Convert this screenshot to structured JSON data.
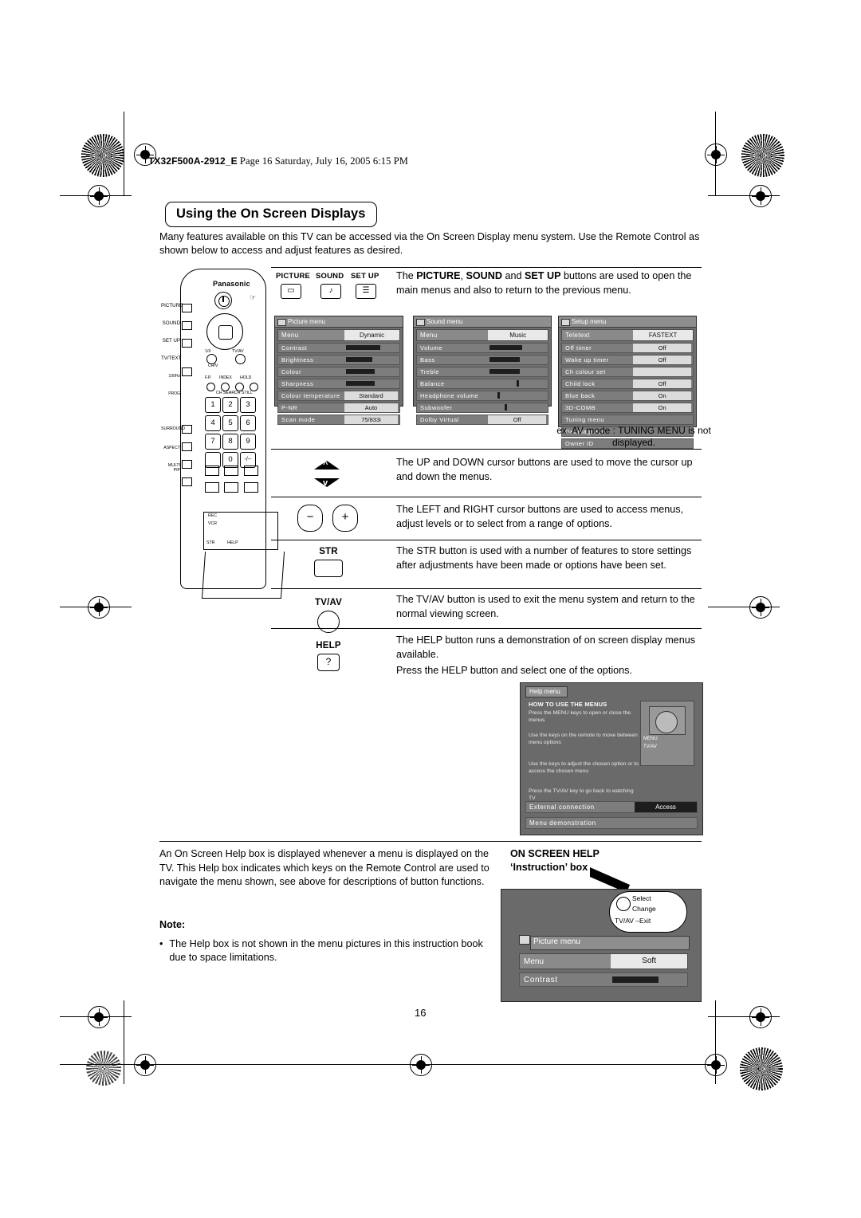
{
  "header": {
    "filename": "TX32F500A-2912_E",
    "pageinfo": "Page 16  Saturday, July 16, 2005  6:15 PM"
  },
  "title": "Using the On Screen Displays",
  "intro": "Many features available on this TV can be accessed via the On Screen Display menu system. Use the Remote Control as shown below to access and adjust features as desired.",
  "remote": {
    "brand": "Panasonic",
    "side_labels": [
      "PICTURE",
      "SOUND",
      "SET UP",
      "TV/TEXT",
      "100Hz PROG"
    ],
    "mid_labels": [
      "F.P.",
      "INDEX",
      "HOLD",
      "CH SEARCH",
      "STILL"
    ],
    "left_labels": [
      "SURROUND",
      "ASPECT",
      "MULTI PIP"
    ],
    "vol_label": "TV/AV",
    "ch_label": "CH/V",
    "prog_label": "1/II",
    "numbers": [
      "1",
      "2",
      "3",
      "4",
      "5",
      "6",
      "7",
      "8",
      "9",
      "0"
    ],
    "dash_key": "-/--",
    "flap_labels": [
      "REC",
      "VCR",
      "STR",
      "HELP"
    ]
  },
  "topbuttons": [
    {
      "label": "PICTURE",
      "glyph": "▭"
    },
    {
      "label": "SOUND",
      "glyph": "♪"
    },
    {
      "label": "SET UP",
      "glyph": "☰"
    }
  ],
  "sections": [
    {
      "text_lead": "The PICTURE, SOUND and SET UP buttons are used to open the main menus and also to return to the previous menu.",
      "bold_terms": [
        "PICTURE",
        "SOUND",
        "SET UP"
      ]
    },
    {
      "key": "UP / DOWN",
      "text": "The UP and DOWN cursor buttons are used to move the cursor up and down the menus."
    },
    {
      "key": "LEFT / RIGHT",
      "text": "The LEFT and RIGHT cursor buttons are used to access menus, adjust levels or to select from a range of options."
    },
    {
      "key": "STR",
      "text": "The STR button is used with a number of features to store settings after adjustments have been made or options have been set."
    },
    {
      "key": "TV/AV",
      "text": "The TV/AV button is used to exit the menu system and return to the normal viewing screen."
    },
    {
      "key": "HELP",
      "text": "The HELP button runs a demonstration of on screen display menus available.",
      "text2": "Press the HELP button and select one of the options."
    }
  ],
  "osd_picture": {
    "title": "Picture menu",
    "header": {
      "key": "Menu",
      "value": "Dynamic"
    },
    "rows": [
      {
        "key": "Contrast",
        "type": "bar",
        "fill": 62
      },
      {
        "key": "Brightness",
        "type": "bar",
        "fill": 48
      },
      {
        "key": "Colour",
        "type": "bar",
        "fill": 52
      },
      {
        "key": "Sharpness",
        "type": "bar",
        "fill": 52
      },
      {
        "key": "Colour temperature",
        "type": "text",
        "value": "Standard"
      },
      {
        "key": "P-NR",
        "type": "text",
        "value": "Auto"
      },
      {
        "key": "Scan mode",
        "type": "text",
        "value": "75/833i"
      }
    ]
  },
  "osd_sound": {
    "title": "Sound menu",
    "header": {
      "key": "Menu",
      "value": "Music"
    },
    "rows": [
      {
        "key": "Volume",
        "type": "bar",
        "fill": 55
      },
      {
        "key": "Bass",
        "type": "bar",
        "fill": 50
      },
      {
        "key": "Treble",
        "type": "bar",
        "fill": 50
      },
      {
        "key": "Balance",
        "type": "tick",
        "fill": 50
      },
      {
        "key": "Headphone volume",
        "type": "tick",
        "fill": 18
      },
      {
        "key": "Subwoofer",
        "type": "tick",
        "fill": 30
      },
      {
        "key": "Dolby Virtual",
        "type": "text",
        "value": "Off"
      }
    ]
  },
  "osd_setup": {
    "title": "Setup menu",
    "header": {
      "key": "Teletext",
      "value": "FASTEXT"
    },
    "rows": [
      {
        "key": "Off timer",
        "type": "text",
        "value": "Off"
      },
      {
        "key": "Wake up timer",
        "type": "text",
        "value": "Off"
      },
      {
        "key": "Ch colour set",
        "type": "text",
        "value": ""
      },
      {
        "key": "Child lock",
        "type": "text",
        "value": "Off"
      },
      {
        "key": "Blue back",
        "type": "text",
        "value": "On"
      },
      {
        "key": "3D-COMB",
        "type": "text",
        "value": "On"
      },
      {
        "key": "Tuning menu",
        "type": "text",
        "value": ""
      },
      {
        "key": "Geomagnetic",
        "type": "text",
        "value": ""
      },
      {
        "key": "Owner ID",
        "type": "text",
        "value": ""
      }
    ]
  },
  "ex_note": "ex. AV mode : TUNING MENU is not displayed.",
  "help_osd": {
    "tab": "Help menu",
    "heading": "HOW TO USE THE MENUS",
    "p1": "Press the MENU keys to open or close the menus",
    "p2": "Use the          keys on the remote to move between menu options",
    "p3": "Use the        keys to adjust the chosen option or to access the chosen menu",
    "p4": "Press the TV/AV key to go back to watching TV",
    "remote_labels": [
      "MENU",
      "TV/AV"
    ],
    "foot1": {
      "key": "External connection",
      "value": "Access"
    },
    "foot2": {
      "key": "Menu demonstration",
      "value": ""
    }
  },
  "lower_text": "An On Screen Help box is displayed whenever a menu is displayed on the TV. This Help box indicates which keys on the Remote Control are used to navigate the menu shown, see above for descriptions of button functions.",
  "note": {
    "label": "Note:",
    "bullet": "The Help box is not shown in the menu pictures in this instruction book due to space limitations."
  },
  "on_screen_help": {
    "line1": "ON SCREEN HELP",
    "line2": "‘Instruction’ box"
  },
  "bubble": {
    "l1": "Select",
    "l2": "Change",
    "l3": "TV/AV –Exit"
  },
  "osd_picture2": {
    "title": "Picture menu",
    "header": {
      "key": "Menu",
      "value": "Soft"
    },
    "row": {
      "key": "Contrast",
      "fill": 60
    }
  },
  "page_number": "16"
}
